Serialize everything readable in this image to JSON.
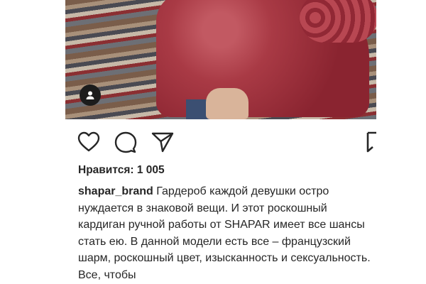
{
  "post": {
    "image_alt": "Женщина в розовом вязаном кардигане",
    "likes_text": "Нравится: 1 005",
    "username": "shapar_brand",
    "caption_text": "Гардероб каждой девушки остро нуждается в знаковой вещи. И этот роскошный кардиган ручной работы от SHAPAR имеет все шансы стать ею. В данной модели есть все – французский шарм, роскошный цвет, изысканность и сексуальность. Все, чтобы"
  },
  "icons": {
    "like": "heart-outline-icon",
    "comment": "comment-bubble-icon",
    "share": "paper-plane-icon",
    "save": "bookmark-icon",
    "tag": "user-tag-icon"
  },
  "colors": {
    "text": "#262626",
    "sweater": "#a93a45",
    "tag_bg": "#1c1c1c"
  }
}
